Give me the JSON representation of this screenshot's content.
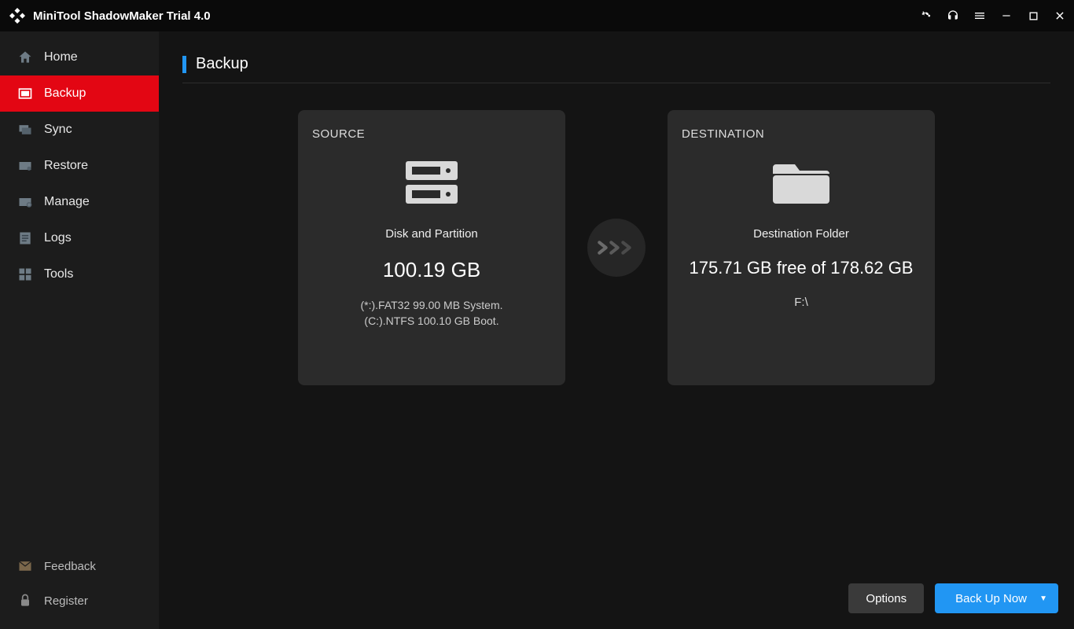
{
  "titlebar": {
    "title": "MiniTool ShadowMaker Trial 4.0"
  },
  "sidebar": {
    "items": [
      {
        "label": "Home"
      },
      {
        "label": "Backup"
      },
      {
        "label": "Sync"
      },
      {
        "label": "Restore"
      },
      {
        "label": "Manage"
      },
      {
        "label": "Logs"
      },
      {
        "label": "Tools"
      }
    ],
    "bottom": [
      {
        "label": "Feedback"
      },
      {
        "label": "Register"
      }
    ]
  },
  "page": {
    "title": "Backup",
    "source": {
      "label": "SOURCE",
      "type": "Disk and Partition",
      "size": "100.19 GB",
      "detail1": "(*:).FAT32 99.00 MB System.",
      "detail2": "(C:).NTFS 100.10 GB Boot."
    },
    "destination": {
      "label": "DESTINATION",
      "type": "Destination Folder",
      "free": "175.71 GB free of 178.62 GB",
      "path": "F:\\"
    }
  },
  "footer": {
    "options": "Options",
    "backup": "Back Up Now"
  }
}
